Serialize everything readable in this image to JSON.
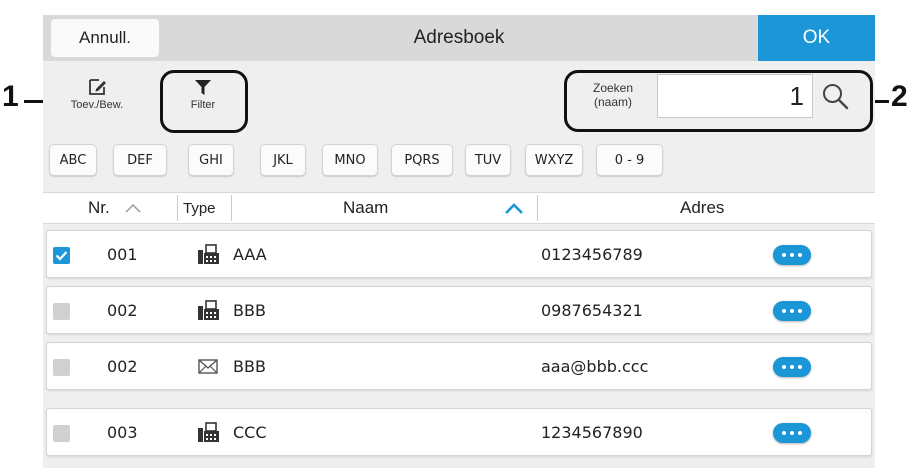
{
  "header": {
    "cancel_label": "Annull.",
    "title": "Adresboek",
    "ok_label": "OK"
  },
  "toolbar": {
    "edit_label": "Toev./Bew.",
    "filter_label": "Filter"
  },
  "search": {
    "label_line1": "Zoeken",
    "label_line2": "(naam)",
    "value": "1"
  },
  "index_buttons": [
    "ABC",
    "DEF",
    "GHI",
    "JKL",
    "MNO",
    "PQRS",
    "TUV",
    "WXYZ",
    "0 - 9"
  ],
  "columns": {
    "nr": "Nr.",
    "type": "Type",
    "name": "Naam",
    "address": "Adres"
  },
  "rows": [
    {
      "checked": true,
      "nr": "001",
      "type_icon": "fax-icon",
      "name": "AAA",
      "address": "0123456789"
    },
    {
      "checked": false,
      "nr": "002",
      "type_icon": "fax-icon",
      "name": "BBB",
      "address": "0987654321"
    },
    {
      "checked": false,
      "nr": "002",
      "type_icon": "envelope-icon",
      "name": "BBB",
      "address": "aaa@bbb.ccc"
    },
    {
      "checked": false,
      "nr": "003",
      "type_icon": "fax-icon",
      "name": "CCC",
      "address": "1234567890"
    }
  ],
  "callouts": [
    "1",
    "2"
  ],
  "colors": {
    "accent": "#1c96d7",
    "header_bg": "#d9d9d9",
    "panel_bg": "#efefef"
  }
}
